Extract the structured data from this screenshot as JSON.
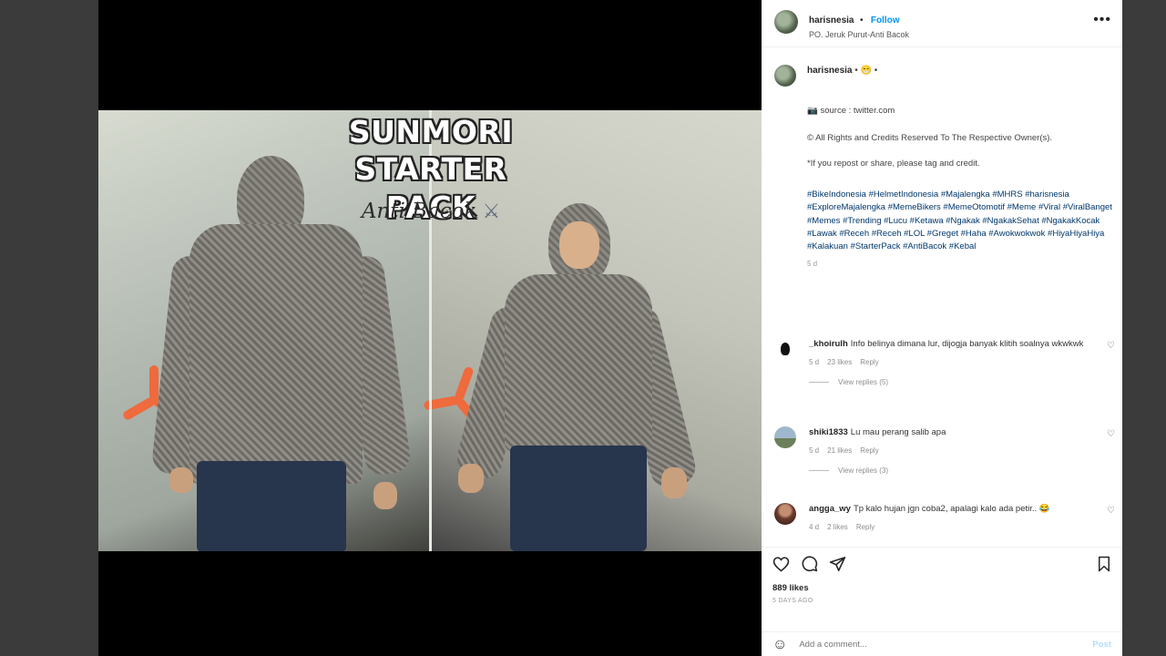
{
  "post": {
    "username": "harisnesia",
    "follow_label": "Follow",
    "location": "PO. Jeruk Purut-Anti Bacok",
    "more_label": "•••"
  },
  "media": {
    "overlay_title_line1": "SUNMORI",
    "overlay_title_line2": "STARTER PACK",
    "overlay_subtitle": "Anti Bacok",
    "sword_icon": "⚔"
  },
  "caption": {
    "username": "harisnesia",
    "emoji_after_name": "😁",
    "source_line": "📷 source : twitter.com",
    "rights_line": "© All Rights and Credits Reserved To The Respective Owner(s).",
    "repost_line": "*If you repost or share, please tag and credit.",
    "hashtags": "#BikeIndonesia #HelmetIndonesia #Majalengka #MHRS #harisnesia #ExploreMajalengka #MemeBikers #MemeOtomotif #Meme #Viral #ViralBanget #Memes #Trending #Lucu #Ketawa #Ngakak #NgakakSehat #NgakakKocak #Lawak #Receh #Receh #LOL #Greget #Haha #Awokwokwok #HiyaHiyaHiya #Kalakuan #StarterPack #AntiBacok #Kebal",
    "time": "5 d"
  },
  "comments": [
    {
      "username": "_khoirulh",
      "text": "Info belinya dimana lur, dijogja banyak klitih soalnya wkwkwk",
      "time": "5 d",
      "likes": "23 likes",
      "reply_label": "Reply",
      "view_replies": "View replies (5)",
      "avatar_color": "#1a1a1a"
    },
    {
      "username": "shiki1833",
      "text": "Lu mau perang salib apa",
      "time": "5 d",
      "likes": "21 likes",
      "reply_label": "Reply",
      "view_replies": "View replies (3)",
      "avatar_color": "#7d9bb5"
    },
    {
      "username": "angga_wy",
      "text": "Tp kalo hujan jgn coba2, apalagi kalo ada petir.. 😂",
      "time": "4 d",
      "likes": "2 likes",
      "reply_label": "Reply",
      "avatar_color": "#6b3b2e"
    }
  ],
  "actions": {
    "like_icon": "heart-outline-icon",
    "comment_icon": "comment-bubble-icon",
    "share_icon": "paper-plane-icon",
    "save_icon": "bookmark-icon",
    "likes_count": "889 likes",
    "time_ago": "5 DAYS AGO",
    "emoji_button": "☺",
    "add_comment_placeholder": "Add a comment...",
    "post_label": "Post"
  },
  "colors": {
    "link_blue": "#0095f6",
    "hashtag_blue": "#00376b",
    "post_disabled": "#b2dffc"
  }
}
